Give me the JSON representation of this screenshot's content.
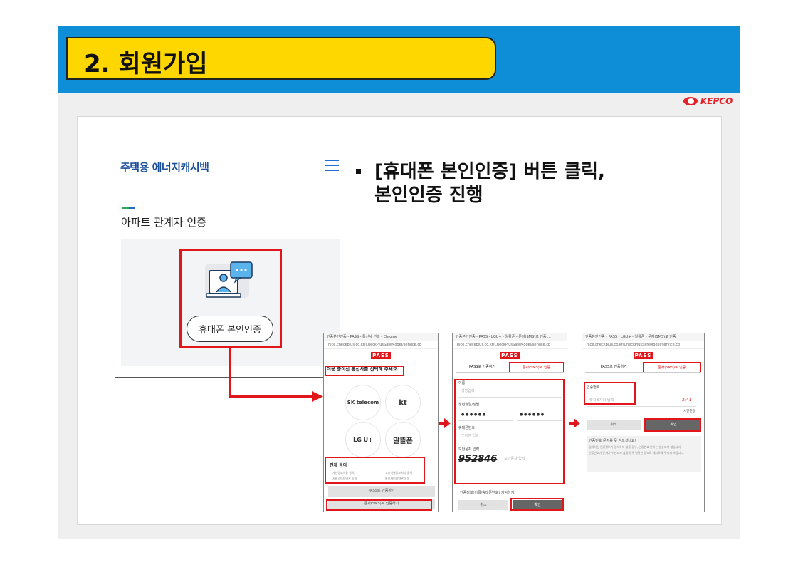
{
  "header": {
    "title": "2. 회원가입",
    "logo_text": "KEPCO",
    "colors": {
      "bar": "#0d8ed7",
      "title_box": "#ffd700",
      "highlight": "#e0161b"
    }
  },
  "site": {
    "brand": "주택용 에너지캐시백",
    "subheading": "아파트 관계자 인증",
    "auth_button": "휴대폰 본인인증",
    "menu_icon": "hamburger-icon",
    "illustration_icon": "video-call-icon"
  },
  "instruction": {
    "line1": "[휴대폰 본인인증] 버튼 클릭,",
    "line2": "본인인증 진행"
  },
  "screen1": {
    "window_title": "인증본인인증 - PASS - 통신사 선택 - Chrome",
    "url": "nice.checkplus.co.kr/CheckPlusSafeModel/service.cb",
    "logo": "PASS",
    "prompt": "이용 중이신 통신사를 선택해 주세요.",
    "carriers": [
      "SK telecom",
      "kt",
      "LG U+",
      "알뜰폰"
    ],
    "agree_all": "전체 동의",
    "agree_items": [
      "개인정보이용 동의",
      "고유식별정보처리 동의",
      "서비스이용약관 동의",
      "통신사이용약관 동의"
    ],
    "pass_button": "PASS로 인증하기",
    "sms_button": "문자(SMS)로 인증하기"
  },
  "screen2": {
    "window_title": "인증본인인증 - PASS - LGU+ - 일활폰 - 문자(SMS)로 인증 ...",
    "url": "nice.checkplus.co.kr/CheckPlusSafeModel/service.cb",
    "logo": "PASS",
    "tab_pass": "PASS로 인증하기",
    "tab_sms": "문자(SMS)로 인증",
    "name_label": "이름",
    "name_placeholder": "성명입력",
    "birth_label": "생년월일/성별",
    "birth_mask": "● ● ● ● ● ●",
    "gender_mask": "● ● ● ● ● ●",
    "phone_label": "휴대폰번호",
    "phone_placeholder": "숫자만 입력",
    "captcha_label": "보안문자 입력",
    "captcha_value": "952846",
    "captcha_placeholder": "보안문자 입력",
    "remember": "인증정보(이름/휴대폰번호) 기억하기",
    "cancel": "취소",
    "confirm": "확인"
  },
  "screen3": {
    "window_title": "인증본인인증 - PASS - LGU+ - 일활폰 - 문자(SMS)로 인증",
    "url": "nice.checkplus.co.kr/CheckPlusSafeModel/service.cb",
    "logo": "PASS",
    "tab_pass": "PASS로 인증하기",
    "tab_sms": "문자(SMS)로 인증",
    "code_label": "인증번호",
    "code_placeholder": "숫자 6자리 입력",
    "timer": "2:41",
    "extend": "시간연장",
    "cancel": "취소",
    "confirm": "확인",
    "help_title": "인증번호 문자를 못 받으셨나요?",
    "help_lines": [
      "입력하신 인증정보가 일치하지 않을 경우, 인증번호 문자는 발송되지 않습니다.",
      "인증번호가 문자가 수신되지 않을 경우 정확한 정보로 재시도해 주시기 바랍니다."
    ]
  }
}
